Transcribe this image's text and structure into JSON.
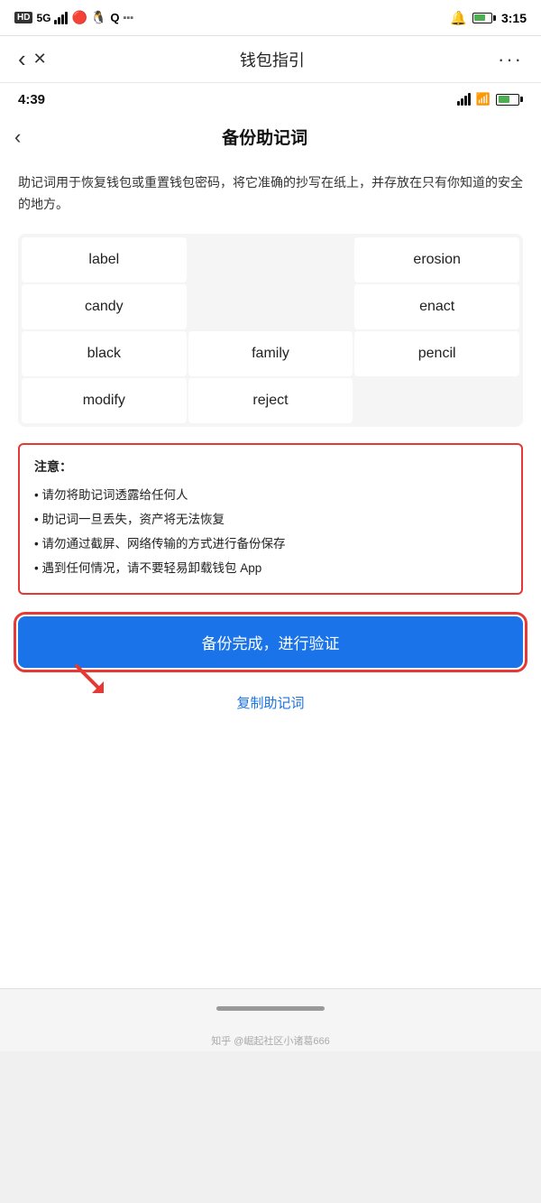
{
  "outer_status": {
    "left_icons": "HD 5G",
    "time": "3:15"
  },
  "app_header": {
    "back_icon": "‹",
    "close_icon": "✕",
    "title": "钱包指引",
    "more_icon": "···"
  },
  "inner_status": {
    "time": "4:39"
  },
  "inner_page": {
    "back_icon": "‹",
    "title": "备份助记词"
  },
  "description": "助记词用于恢复钱包或重置钱包密码，将它准确的抄写在纸上，并存放在只有你知道的安全的地方。",
  "mnemonic_words": [
    {
      "word": "label",
      "col": 0
    },
    {
      "word": "",
      "col": 1
    },
    {
      "word": "erosion",
      "col": 2
    },
    {
      "word": "candy",
      "col": 0
    },
    {
      "word": "",
      "col": 1
    },
    {
      "word": "enact",
      "col": 2
    },
    {
      "word": "black",
      "col": 0
    },
    {
      "word": "family",
      "col": 1
    },
    {
      "word": "pencil",
      "col": 2
    },
    {
      "word": "modify",
      "col": 0
    },
    {
      "word": "reject",
      "col": 1
    },
    {
      "word": "",
      "col": 2
    }
  ],
  "warning": {
    "title": "注意：",
    "items": [
      "• 请勿将助记词透露给任何人",
      "• 助记词一旦丢失，资产将无法恢复",
      "• 请勿通过截屏、网络传输的方式进行备份保存",
      "• 遇到任何情况，请不要轻易卸载钱包 App"
    ]
  },
  "buttons": {
    "primary": "备份完成，进行验证",
    "secondary": "复制助记词"
  },
  "watermark": "知乎 @崛起社区小诸葛666"
}
